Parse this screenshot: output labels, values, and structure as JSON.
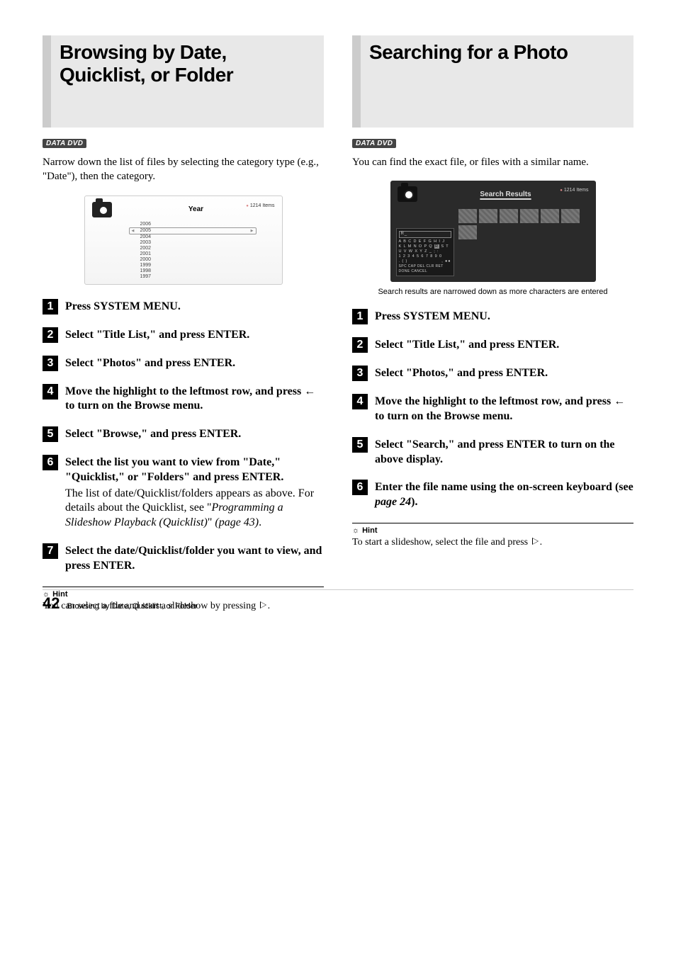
{
  "left": {
    "title": "Browsing by Date, Quicklist, or Folder",
    "badge": "DATA DVD",
    "intro": "Narrow down the list of files by selecting the category type (e.g., \"Date\"), then the category.",
    "screenshot": {
      "heading": "Year",
      "count": "1214 Items",
      "years": [
        "2006",
        "2005",
        "2004",
        "2003",
        "2002",
        "2001",
        "2000",
        "1999",
        "1998",
        "1997"
      ],
      "selected_index": 1
    },
    "steps": [
      {
        "n": "1",
        "bold": "Press SYSTEM MENU."
      },
      {
        "n": "2",
        "bold": "Select \"Title List,\" and press ENTER."
      },
      {
        "n": "3",
        "bold": "Select \"Photos\" and press ENTER."
      },
      {
        "n": "4",
        "bold_pre": "Move the highlight to the leftmost row, and press ",
        "arrow": "←",
        "bold_post": " to turn on the Browse menu."
      },
      {
        "n": "5",
        "bold": "Select \"Browse,\" and press ENTER."
      },
      {
        "n": "6",
        "bold": "Select the list you want to view from \"Date,\" \"Quicklist,\" or \"Folders\" and press ENTER.",
        "sub_pre": "The list of date/Quicklist/folders appears as above. For details about the Quicklist, see \"",
        "sub_ref": "Programming a Slideshow Playback (Quicklist)",
        "sub_post": "\" ",
        "sub_page": "(page 43)",
        "sub_end": "."
      },
      {
        "n": "7",
        "bold": "Select the date/Quicklist/folder you want to view, and press ENTER."
      }
    ],
    "hint_label": "Hint",
    "hint_pre": "You can select a file and start a slideshow by pressing ",
    "hint_post": "."
  },
  "right": {
    "title": "Searching for a Photo",
    "badge": "DATA DVD",
    "intro": "You can find the exact file, or files with a similar name.",
    "screenshot": {
      "heading": "Search Results",
      "count": "1214 Items",
      "input": "R",
      "key_rows": [
        "A B C D E F G H I J",
        "K L M N O P Q",
        "U V W X Y Z",
        "1 2 3 4 5 6 7 8 9 0",
        ". ( )"
      ],
      "highlight": "R",
      "key_tail": "S T",
      "key_spacer": "_ ; :",
      "sym_row": ", ●●",
      "btn_row": "SPC CAP DEL CLR RET",
      "bottom_row": "DONE   CANCEL"
    },
    "caption": "Search results are narrowed down as more characters are entered",
    "steps": [
      {
        "n": "1",
        "bold": "Press SYSTEM MENU."
      },
      {
        "n": "2",
        "bold": "Select \"Title List,\" and press ENTER."
      },
      {
        "n": "3",
        "bold": "Select \"Photos,\" and press ENTER."
      },
      {
        "n": "4",
        "bold_pre": "Move the highlight to the leftmost row, and press ",
        "arrow": "←",
        "bold_post": " to turn on the Browse menu."
      },
      {
        "n": "5",
        "bold": "Select \"Search,\" and press ENTER to turn on the above display."
      },
      {
        "n": "6",
        "bold_pre": "Enter the file name using the on-screen keyboard (see ",
        "ref": "page 24",
        "bold_post": ")."
      }
    ],
    "hint_label": "Hint",
    "hint_pre": "To start a slideshow, select the file and press ",
    "hint_post": "."
  },
  "footer": {
    "page": "42",
    "text": "Browsing by Date, Quicklist, or Folder"
  }
}
